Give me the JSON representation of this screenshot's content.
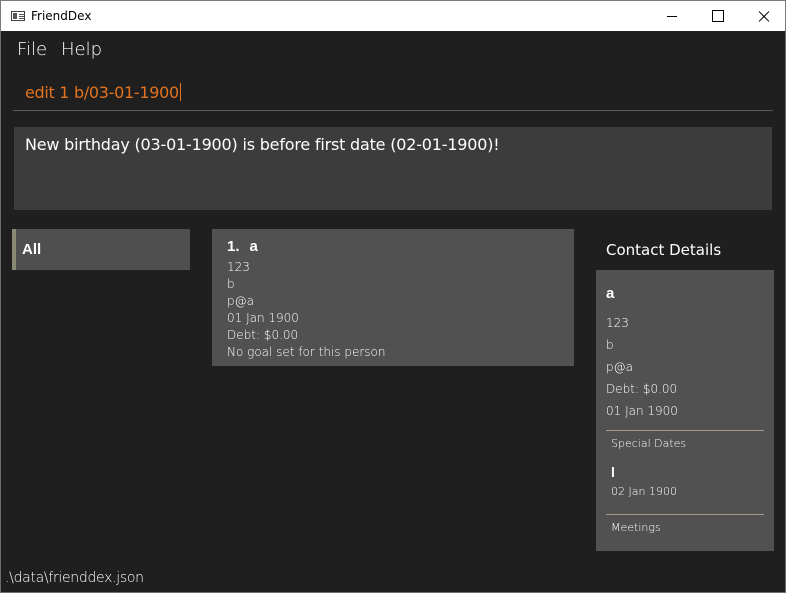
{
  "window": {
    "title": "FriendDex",
    "icon": "app-icon"
  },
  "menu": {
    "file": "File",
    "help": "Help"
  },
  "command": {
    "value": "edit 1 b/03-01-1900"
  },
  "result": {
    "message": "New birthday (03-01-1900) is before first date (02-01-1900)!"
  },
  "tags": [
    {
      "label": "All"
    }
  ],
  "persons": [
    {
      "index": "1.",
      "name": "a",
      "phone": "123",
      "address": "b",
      "email": "p@a",
      "birthday": "01 Jan 1900",
      "debt": "Debt: $0.00",
      "goal": "No goal set for this person"
    }
  ],
  "details": {
    "header": "Contact Details",
    "name": "a",
    "phone": "123",
    "address": "b",
    "email": "p@a",
    "debt": "Debt: $0.00",
    "birthday": "01 Jan 1900",
    "special_dates_label": "Special Dates",
    "special_date_title": "l",
    "special_date_value": "02 Jan 1900",
    "meetings_label": "Meetings"
  },
  "status": {
    "path": ".\\data\\frienddex.json"
  },
  "colors": {
    "background": "#1f1f1f",
    "panel": "#515151",
    "result_panel": "#3c3c3c",
    "command_text": "#e4731f",
    "divider": "#a69a86"
  }
}
